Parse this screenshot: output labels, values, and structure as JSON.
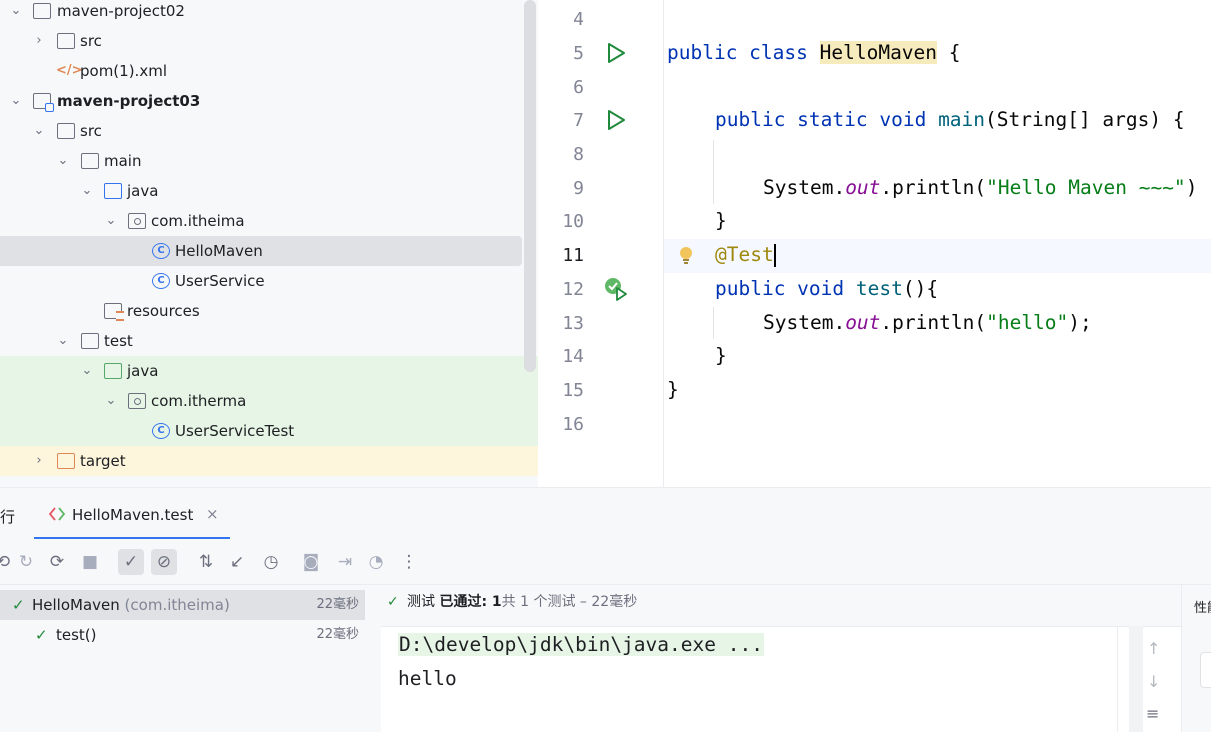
{
  "project_tree": {
    "rows": [
      {
        "label": "maven-project02",
        "bold": false
      },
      {
        "label": "src"
      },
      {
        "label": "pom(1).xml"
      },
      {
        "label": "maven-project03",
        "bold": true
      },
      {
        "label": "src"
      },
      {
        "label": "main"
      },
      {
        "label": "java"
      },
      {
        "label": "com.itheima"
      },
      {
        "label": "HelloMaven",
        "selected": true
      },
      {
        "label": "UserService"
      },
      {
        "label": "resources"
      },
      {
        "label": "test"
      },
      {
        "label": "java"
      },
      {
        "label": "com.itherma"
      },
      {
        "label": "UserServiceTest"
      },
      {
        "label": "target"
      }
    ]
  },
  "editor": {
    "line_numbers": [
      "4",
      "5",
      "6",
      "7",
      "8",
      "9",
      "10",
      "11",
      "12",
      "13",
      "14",
      "15",
      "16"
    ],
    "current_line": "11",
    "code": {
      "l5_kw": "public class ",
      "l5_name": "HelloMaven",
      "l5_rest": " {",
      "l7_kw": "public static void ",
      "l7_mth": "main",
      "l7_rest": "(String[] args) {",
      "l9_pre": "System.",
      "l9_fld": "out",
      "l9_call": ".println(",
      "l9_str": "\"Hello Maven ~~~\"",
      "l9_end": ")",
      "l10": "}",
      "l11_ann": "@Test",
      "l12_kw": "public void ",
      "l12_mth": "test",
      "l12_rest": "(){",
      "l13_pre": "System.",
      "l13_fld": "out",
      "l13_call": ".println(",
      "l13_str": "\"hello\"",
      "l13_end": ");",
      "l14": "}",
      "l15": "}"
    }
  },
  "run_window": {
    "left_label": "行",
    "tab_label": "HelloMaven.test",
    "test_tree": [
      {
        "name": "HelloMaven",
        "detail": " (com.itheima)",
        "time": "22毫秒"
      },
      {
        "name": "test()",
        "time": "22毫秒"
      }
    ],
    "status": {
      "prefix": "测试 ",
      "passed": "已通过: 1",
      "suffix": "共 1 个测试 – 22毫秒"
    },
    "console_lines": [
      "D:\\develop\\jdk\\bin\\java.exe ...",
      "hello"
    ],
    "right_label": "性能"
  }
}
